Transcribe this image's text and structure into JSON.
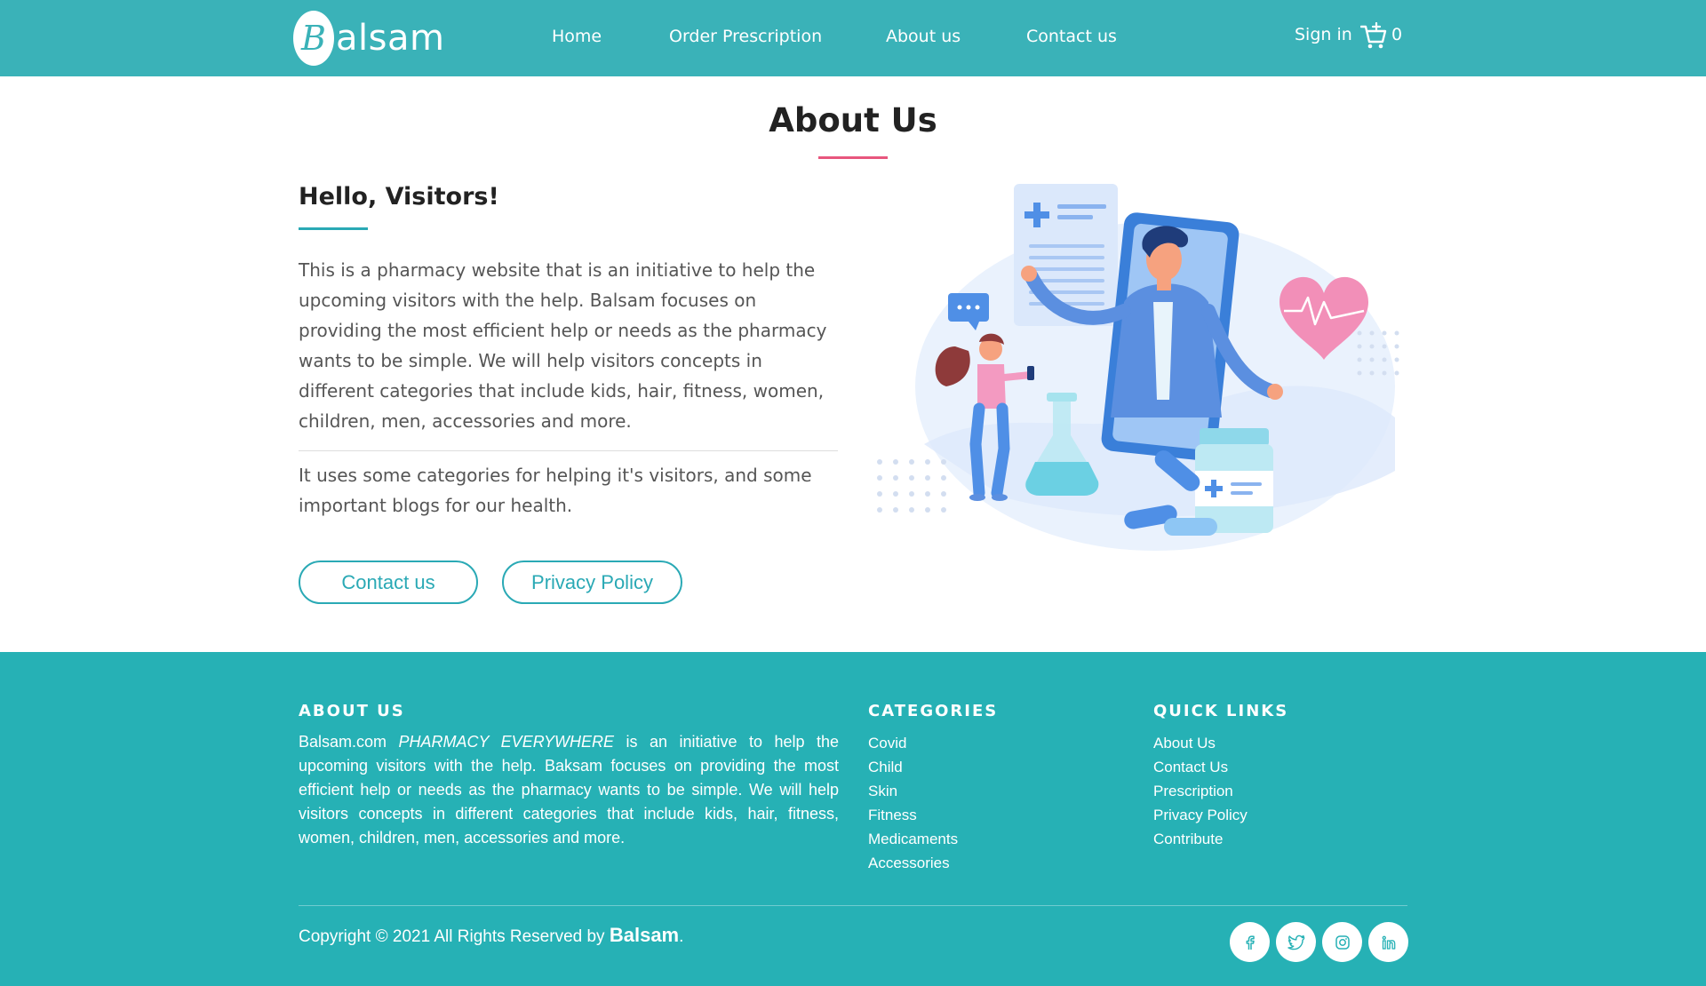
{
  "nav": {
    "logo_letter": "B",
    "logo_text": "alsam",
    "links": [
      {
        "label": "Home"
      },
      {
        "label": "Order Prescription"
      },
      {
        "label": "About us"
      },
      {
        "label": "Contact us"
      }
    ],
    "sign_in": "Sign in",
    "cart_count": "0",
    "icons": {
      "cart": "cart-icon"
    }
  },
  "about": {
    "title": "About Us",
    "greeting": "Hello, Visitors!",
    "paragraph1": "This is a pharmacy website that is an initiative to help the upcoming visitors with the help. Balsam focuses on providing the most efficient help or needs as the pharmacy wants to be simple. We will help visitors concepts in different categories that include kids, hair, fitness, women, children, men, accessories and more.",
    "paragraph2": "It uses some categories for helping it's visitors, and some important blogs for our health.",
    "buttons": {
      "contact": "Contact us",
      "privacy": "Privacy Policy"
    }
  },
  "footer": {
    "about_heading": "ABOUT US",
    "about_text_prefix": "Balsam.com",
    "about_text_emphasis": "PHARMACY EVERYWHERE",
    "about_text_rest": "is an initiative to help the upcoming visitors with the help. Baksam focuses on providing the most efficient help or needs as the pharmacy wants to be simple. We will help visitors concepts in different categories that include kids, hair, fitness, women, children, men, accessories and more.",
    "categories_heading": "CATEGORIES",
    "categories": [
      "Covid",
      "Child",
      "Skin",
      "Fitness",
      "Medicaments",
      "Accessories"
    ],
    "quick_links_heading": "QUICK LINKS",
    "quick_links": [
      "About Us",
      "Contact Us",
      "Prescription",
      "Privacy Policy",
      "Contribute"
    ],
    "copyright": "Copyright © 2021 All Rights Reserved by",
    "copyright_brand": "Balsam",
    "copyright_end": ".",
    "social_icons": [
      "facebook-icon",
      "twitter-icon",
      "instagram-icon",
      "linkedin-icon"
    ]
  },
  "colors": {
    "nav_bg": "#3ab2b8",
    "footer_bg": "#26b1b5",
    "accent": "#2aa9b5",
    "title_underline": "#e8567e"
  }
}
